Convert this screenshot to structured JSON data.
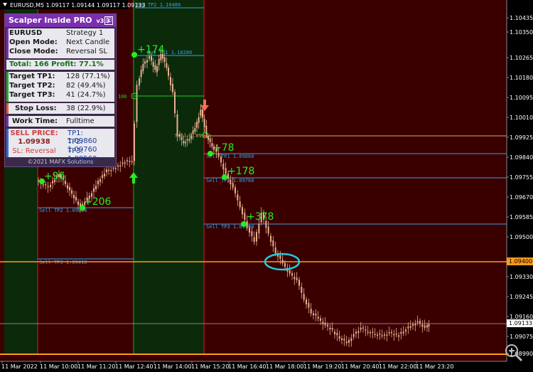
{
  "symbol_header": "EURUSD,M5  1.09117 1.09144 1.09117 1.09133",
  "panel": {
    "title": "Scalper Inside PRO",
    "version": "v3.3",
    "checkbox": "☑",
    "symbol": "EURUSD",
    "strategy": "Strategy 1",
    "open_mode_label": "Open Mode:",
    "open_mode_value": "Next Candle",
    "close_mode_label": "Close Mode:",
    "close_mode_value": "Reversal SL",
    "total": "Total: 166  Profit: 77.1%",
    "tp1_label": "Target TP1:",
    "tp1_value": "128 (77.1%)",
    "tp2_label": "Target TP2:",
    "tp2_value": "82 (49.4%)",
    "tp3_label": "Target TP3:",
    "tp3_value": "41 (24.7%)",
    "sl_label": "Stop Loss:",
    "sl_value": "38 (22.9%)",
    "work_label": "Work Time:",
    "work_value": "Fulltime",
    "sell_price_label": "SELL PRICE:",
    "sell_price": "1.09938",
    "sl_mode": "SL: Reversal",
    "sell_tp1": "TP1: 1.09860",
    "sell_tp2": "TP2: 1.09760",
    "sell_tp3": "TP3: 1.09560",
    "copyright": "©2021 MAFX Solutions"
  },
  "price_axis": [
    "1.10435",
    "1.10350",
    "1.10265",
    "1.10180",
    "1.10095",
    "1.10010",
    "1.09925",
    "1.09840",
    "1.09755",
    "1.09670",
    "1.09585",
    "1.09500",
    "1.09400",
    "1.09330",
    "1.09245",
    "1.09160",
    "1.09133",
    "1.09075",
    "1.08990"
  ],
  "price_tags": {
    "line": "1.09400",
    "current": "1.09133"
  },
  "time_axis": [
    "11 Mar 2022",
    "11 Mar 10:00",
    "11 Mar 11:20",
    "11 Mar 12:40",
    "11 Mar 14:00",
    "11 Mar 15:20",
    "11 Mar 16:40",
    "11 Mar 18:00",
    "11 Mar 19:20",
    "11 Mar 20:40",
    "11 Mar 22:00",
    "11 Mar 23:20"
  ],
  "level_labels": {
    "buy_tp2": "Buy TP2 1.10480",
    "buy_tp1": "Buy TP1 1.10280",
    "sell_tp2_a": "Sell TP2 1.09860",
    "sell_tp3_a": "Sell TP3 1.09410",
    "sell_tp1_b": "Sell TP1 1.09860",
    "sell_tp2_b": "Sell TP2 1.09760",
    "sell_tp3_b": "Sell TP3 1.09560",
    "mid_a": "106",
    "mid_b": "Sell 1.0993"
  },
  "signals": {
    "plus_96": "+96",
    "plus_206": "+206",
    "plus_174": "+174",
    "plus_78a": "+78",
    "plus_178": "+178",
    "plus_378": "+378"
  },
  "colors": {
    "bg": "#3a0000",
    "green_zone": "#0a2a0a",
    "candle": "#e8b090",
    "zone_red": "#cc2222",
    "zone_green": "#22aa22"
  }
}
